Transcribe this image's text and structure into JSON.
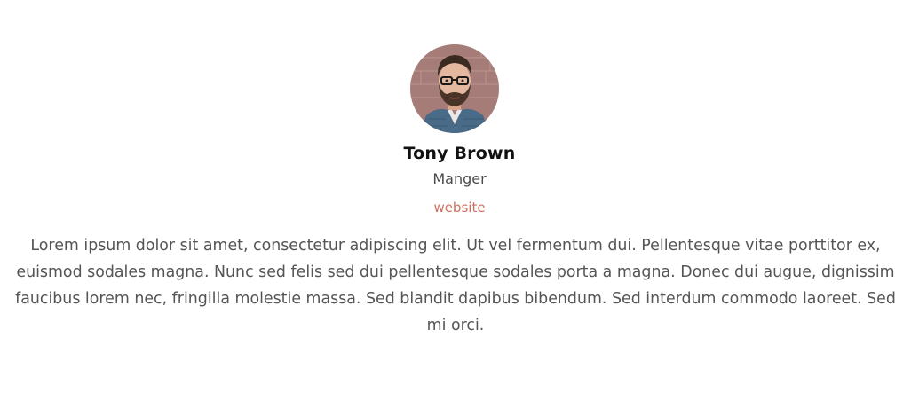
{
  "profile": {
    "name": "Tony Brown",
    "role": "Manger",
    "website_label": "website",
    "bio": "Lorem ipsum dolor sit amet, consectetur adipiscing elit. Ut vel fermentum dui. Pellentesque vitae porttitor ex, euismod sodales magna. Nunc sed felis sed dui pellentesque sodales porta a magna. Donec dui augue, dignissim faucibus lorem nec, fringilla molestie massa. Sed blandit dapibus bibendum. Sed interdum commodo laoreet. Sed mi orci.",
    "avatar_icon": "user-avatar-photo"
  },
  "colors": {
    "link": "#cf6f62",
    "name": "#111111",
    "body_text": "#555555"
  }
}
